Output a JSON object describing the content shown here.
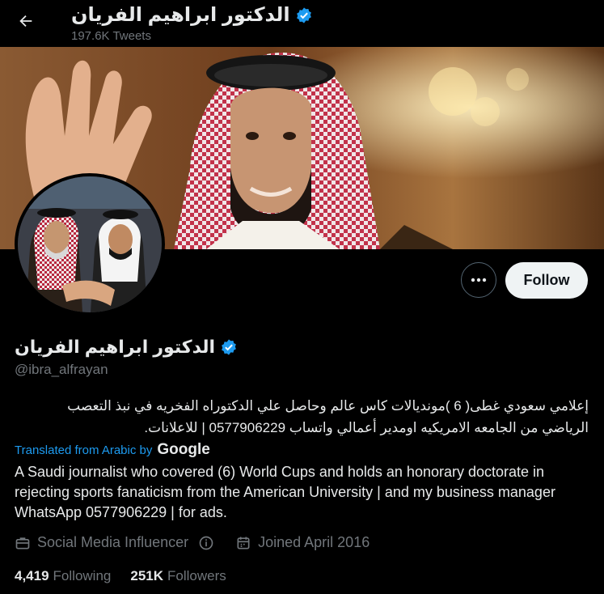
{
  "header": {
    "display_name": "الدكتور ابراهيم الفريان",
    "tweet_count": "197.6K Tweets"
  },
  "profile": {
    "display_name": "الدكتور ابراهيم الفريان",
    "handle": "@ibra_alfrayan",
    "verified": true,
    "bio_line1": "إعلامي سعودي غطى( 6 )مونديالات كاس عالم وحاصل علي الدكتوراه الفخريه في نبذ التعصب",
    "bio_line2": "الرياضي من الجامعه الامريكيه اومدير أعمالي واتساب 0577906229 | للاعلانات.",
    "translated_label": "Translated from Arabic by",
    "translator": "Google",
    "translation": "A Saudi journalist who covered (6) World Cups and holds an honorary doctorate in rejecting sports fanaticism from the American University | and my business manager WhatsApp 0577906229 | for ads.",
    "category": "Social Media Influencer",
    "joined": "Joined April 2016",
    "following_count": "4,419",
    "following_label": "Following",
    "followers_count": "251K",
    "followers_label": "Followers"
  },
  "actions": {
    "follow_label": "Follow"
  },
  "icons": {
    "back": "arrow-left-icon",
    "verified": "verified-badge-icon",
    "more": "more-dots-icon",
    "category": "briefcase-icon",
    "info": "info-icon",
    "calendar": "calendar-icon"
  },
  "colors": {
    "background": "#000000",
    "text": "#e7e9ea",
    "muted": "#71767b",
    "accent": "#1d9bf0",
    "follow_bg": "#eff3f4"
  }
}
